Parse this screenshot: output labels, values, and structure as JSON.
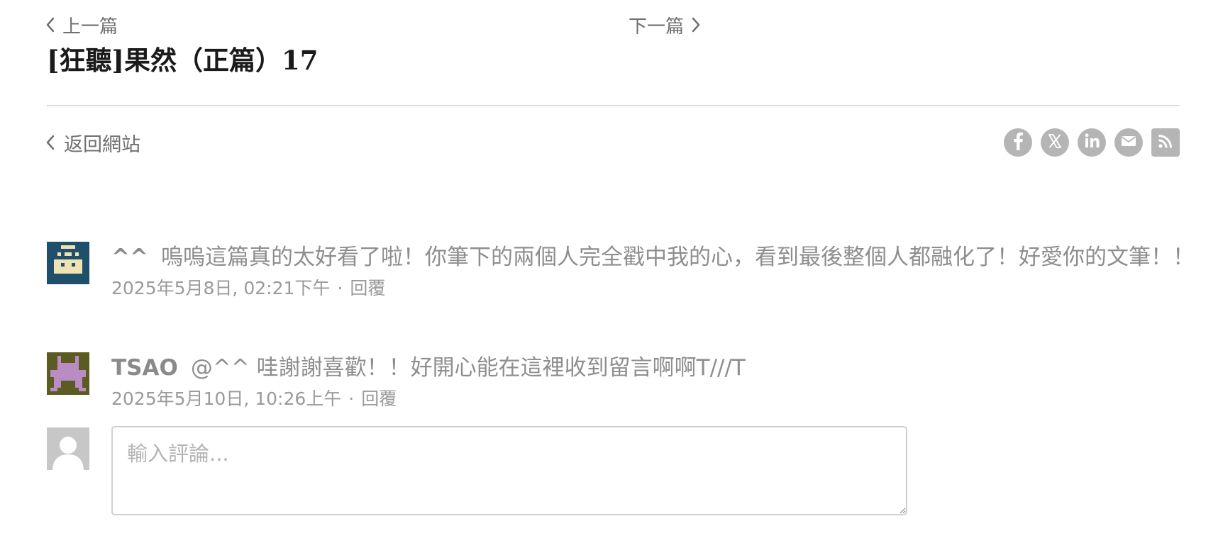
{
  "navigation": {
    "prev_label": "上一篇",
    "next_label": "下一篇"
  },
  "post": {
    "title": "[狂聽]果然（正篇）17"
  },
  "back_link": {
    "label": "返回網站"
  },
  "share_icons": [
    "facebook-icon",
    "x-icon",
    "linkedin-icon",
    "email-icon",
    "rss-icon"
  ],
  "comments": [
    {
      "author": "^^",
      "text": "嗚嗚這篇真的太好看了啦！你筆下的兩個人完全戳中我的心，看到最後整個人都融化了！好愛你的文筆！！",
      "timestamp": "2025年5月8日, 02:21下午",
      "separator": "·",
      "reply_label": "回覆",
      "avatar_bg": "#1f4f6b",
      "avatar_fg": "#efe2b3"
    },
    {
      "author": "TSAO",
      "text": "@^^ 哇謝謝喜歡！！好開心能在這裡收到留言啊啊T///T",
      "timestamp": "2025年5月10日, 10:26上午",
      "separator": "·",
      "reply_label": "回覆",
      "avatar_bg": "#5b5b22",
      "avatar_fg": "#b98cc4"
    }
  ],
  "comment_form": {
    "placeholder": "輸入評論..."
  },
  "colors": {
    "icon_gray": "#b5b5b5",
    "divider": "#dddddd",
    "title": "#1a1a1a"
  }
}
